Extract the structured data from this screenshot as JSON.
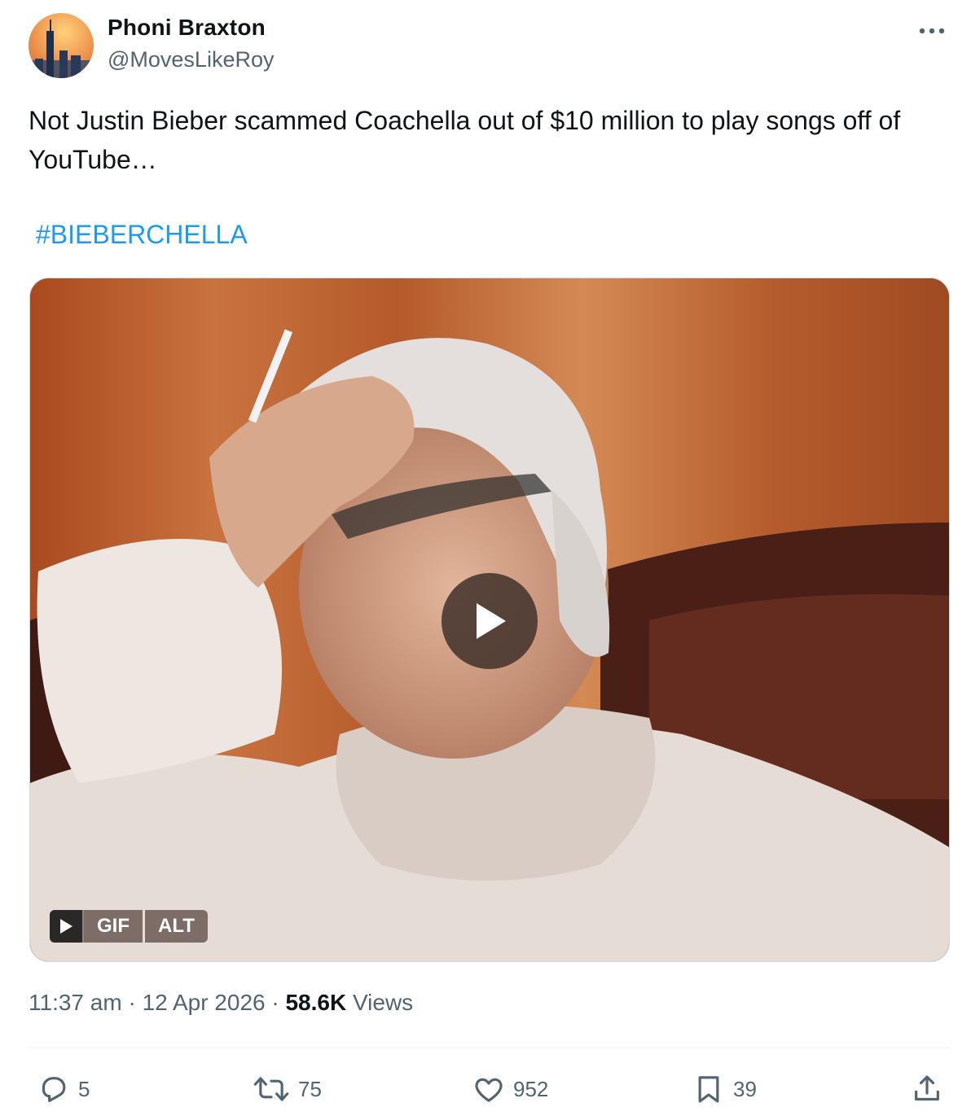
{
  "author": {
    "display_name": "Phoni Braxton",
    "handle": "@MovesLikeRoy",
    "avatar_icon": "avatar-skyline-sunset"
  },
  "tweet": {
    "text": "Not Justin Bieber scammed Coachella out of $10 million to play songs off of YouTube…",
    "hashtag": "#BIEBERCHELLA"
  },
  "media": {
    "type": "gif",
    "play_icon": "play-icon",
    "badges": {
      "gif_label": "GIF",
      "alt_label": "ALT"
    }
  },
  "meta": {
    "time": "11:37 am",
    "separator1": " · ",
    "date": "12 Apr 2026",
    "separator2": " · ",
    "views_count": "58.6K",
    "views_label": " Views"
  },
  "actions": {
    "replies": "5",
    "reposts": "75",
    "likes": "952",
    "bookmarks": "39"
  },
  "colors": {
    "accent": "#1d9bf0",
    "secondary_text": "#536471",
    "primary_text": "#0f1419"
  }
}
